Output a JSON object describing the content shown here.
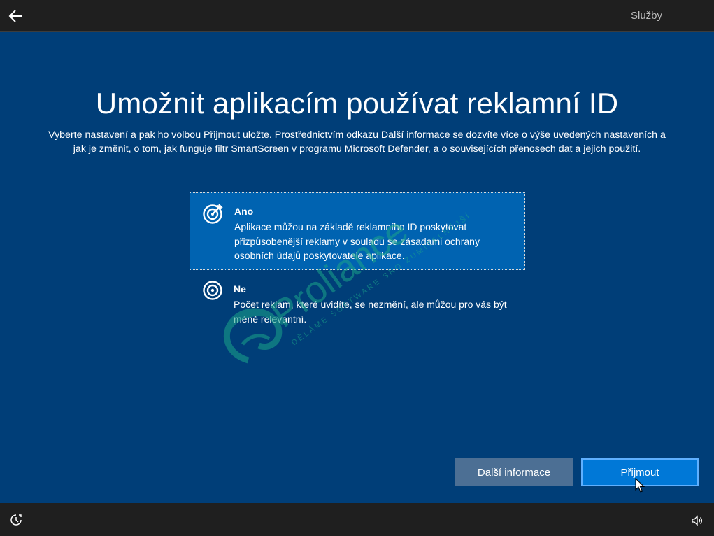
{
  "header": {
    "tab_label": "Služby"
  },
  "main": {
    "title": "Umožnit aplikacím používat reklamní ID",
    "description_line1": "Vyberte nastavení a pak ho volbou Přijmout uložte. Prostřednictvím odkazu Další informace se dozvíte více o výše uvedených nastaveních a",
    "description_line2": "jak je změnit, o tom, jak funguje filtr SmartScreen v programu Microsoft Defender, a o souvisejících přenosech dat a jejich použití.",
    "options": [
      {
        "title": "Ano",
        "text": "Aplikace můžou na základě reklamního ID poskytovat přizpůsobenější reklamy v souladu se zásadami ochrany osobních údajů poskytovatele aplikace.",
        "selected": true,
        "icon": "target-arrow-icon"
      },
      {
        "title": "Ne",
        "text": "Počet reklam, které uvidíte, se nezmění, ale můžou pro vás být méně relevantní.",
        "selected": false,
        "icon": "target-icon"
      }
    ]
  },
  "buttons": {
    "more_info": "Další informace",
    "accept": "Přijmout"
  },
  "watermark": {
    "brand": "Proliance",
    "tagline": "DĚLÁME SOFTWARE SRO ZUMITELNĚJŠÍ"
  },
  "colors": {
    "background": "#003e78",
    "selected_option": "#0063b1",
    "accent_button": "#0078d7",
    "secondary_button": "#4c6f94",
    "bars": "#1f1f1f"
  }
}
